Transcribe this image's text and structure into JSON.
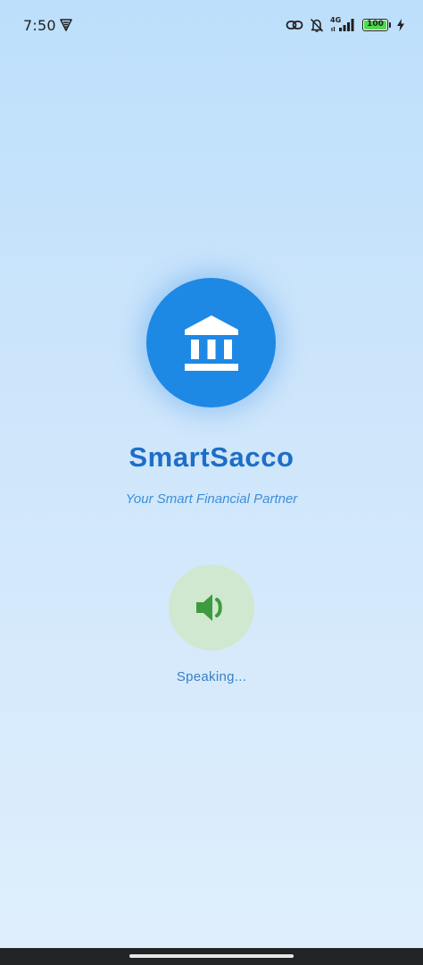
{
  "status_bar": {
    "time": "7:50",
    "network_type": "4G",
    "battery_level": "100",
    "battery_fraction": 1.0,
    "icons": [
      "vpn-icon",
      "link-icon",
      "muted-bell-icon",
      "signal-icon",
      "battery-icon",
      "charging-icon"
    ]
  },
  "app": {
    "name": "SmartSacco",
    "tagline": "Your Smart Financial Partner",
    "logo_icon": "bank-icon"
  },
  "voice": {
    "icon": "speaker-icon",
    "status": "Speaking..."
  },
  "colors": {
    "primary": "#1e88e5",
    "title": "#1e6ec6",
    "tagline": "#3d8fd8",
    "speaker_bg": "#cfe8cf",
    "speaker_icon": "#3f9a3f",
    "battery_fill": "#4cdb4c"
  }
}
